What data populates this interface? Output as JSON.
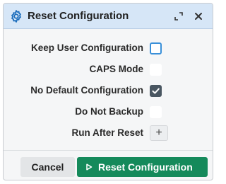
{
  "dialog": {
    "title": "Reset Configuration",
    "title_icon": "gear-icon",
    "controls": {
      "expand_icon": "expand-icon",
      "close_icon": "close-icon"
    }
  },
  "options": [
    {
      "label": "Keep User Configuration",
      "type": "checkbox",
      "checked": false,
      "focused": true
    },
    {
      "label": "CAPS Mode",
      "type": "checkbox",
      "checked": false
    },
    {
      "label": "No Default Configuration",
      "type": "checkbox",
      "checked": true
    },
    {
      "label": "Do Not Backup",
      "type": "checkbox",
      "checked": false
    },
    {
      "label": "Run After Reset",
      "type": "add-button",
      "button_text": "+"
    }
  ],
  "footer": {
    "cancel_label": "Cancel",
    "primary_label": "Reset Configuration",
    "primary_icon": "play-icon"
  },
  "colors": {
    "titlebar_bg": "#d6e6f7",
    "accent_focus": "#3a90d9",
    "primary_button": "#158a5b",
    "checked_box": "#495661",
    "gear_icon": "#1f6fbd"
  }
}
